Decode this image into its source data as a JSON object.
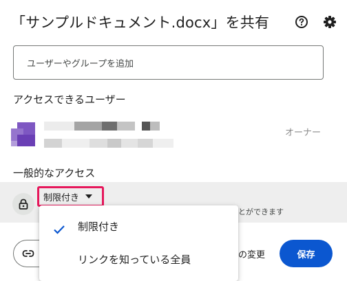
{
  "dialog": {
    "title": "「サンプルドキュメント.docx」を共有",
    "help_icon": "help-circle-icon",
    "settings_icon": "gear-icon"
  },
  "add_people": {
    "placeholder": "ユーザーやグループを追加"
  },
  "people_access": {
    "heading": "アクセスできるユーザー",
    "owner_role": "オーナー"
  },
  "general_access": {
    "heading": "一般的なアクセス",
    "selected": "制限付き",
    "description_partial": "ことができます",
    "lock_icon": "lock-icon"
  },
  "dropdown": {
    "options": [
      "制限付き",
      "リンクを知っている全員"
    ],
    "selected_index": 0
  },
  "footer": {
    "change_partial": "の変更",
    "save_label": "保存",
    "copy_link_icon": "link-icon"
  },
  "colors": {
    "accent": "#0b57d0",
    "highlight": "#e6175b",
    "avatar": "#7e57c2"
  }
}
